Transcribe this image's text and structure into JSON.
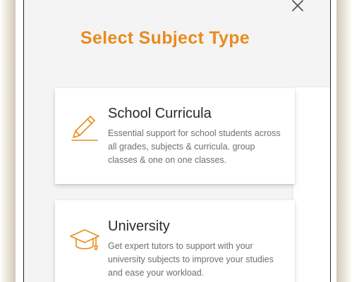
{
  "modal": {
    "title": "Select Subject Type",
    "close_icon": "close-icon"
  },
  "accent_color": "#e98b1e",
  "options": [
    {
      "icon": "pencil-icon",
      "title": "School Curricula",
      "description": "Essential support for school students across all grades, subjects & curricula. group classes & one on one classes."
    },
    {
      "icon": "graduation-cap-icon",
      "title": "University",
      "description": "Get expert tutors to support with your university subjects to improve your studies and ease your workload."
    }
  ]
}
